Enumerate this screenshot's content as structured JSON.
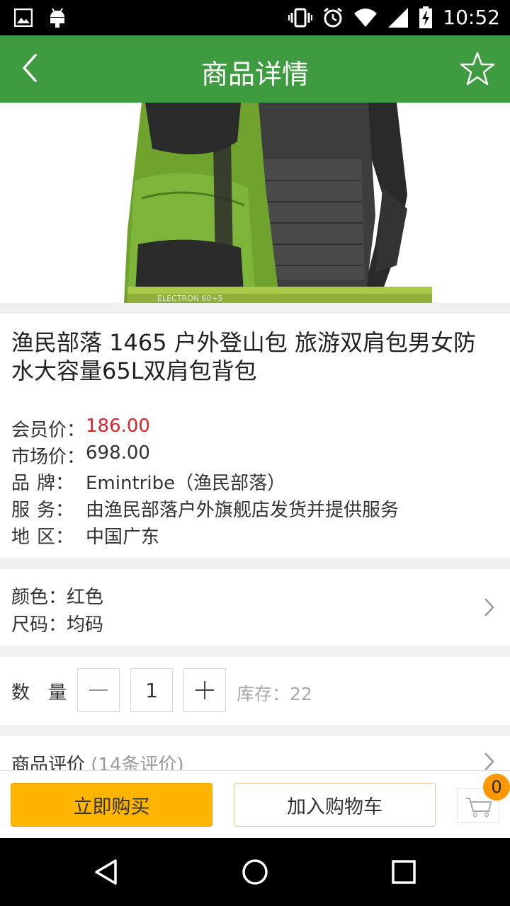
{
  "status_bar": {
    "time": "10:52"
  },
  "app_bar": {
    "title": "商品详情"
  },
  "product": {
    "title": "渔民部落 1465 户外登山包 旅游双肩包男女防水大容量65L双肩包背包",
    "hero_text": "ELECTRON 60+5",
    "member_price_label": "会员价：",
    "member_price": "186.00",
    "market_price_label": "市场价：",
    "market_price": "698.00",
    "brand_label_1": "品",
    "brand_label_2": "牌：",
    "brand": "Emintribe（渔民部落）",
    "service_label_1": "服",
    "service_label_2": "务：",
    "service": "由渔民部落户外旗舰店发货并提供服务",
    "region_label_1": "地",
    "region_label_2": "区：",
    "region": "中国广东"
  },
  "spec": {
    "color_label": "颜色：",
    "color": "红色",
    "size_label": "尺码：",
    "size": "均码"
  },
  "quantity": {
    "label_1": "数",
    "label_2": "量",
    "value": "1",
    "stock_label": "库存：",
    "stock": "22"
  },
  "reviews": {
    "label": "商品评价",
    "count": "(14条评价)"
  },
  "bottom": {
    "buy_now": "立即购买",
    "add_to_cart": "加入购物车",
    "cart_count": "0"
  },
  "colors": {
    "primary": "#3f9b3f",
    "price": "#d8252b",
    "buy_button": "#ffb400",
    "badge": "#ff9800"
  }
}
